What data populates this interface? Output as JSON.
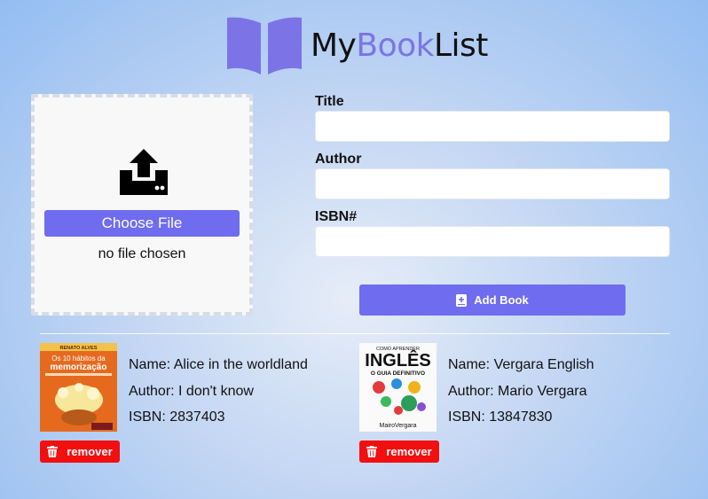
{
  "header": {
    "brand_part1": "My",
    "brand_part2": "Book",
    "brand_part3": "List",
    "logo_icon": "open-book-icon"
  },
  "upload": {
    "icon": "upload-icon",
    "choose_label": "Choose File",
    "status": "no file chosen"
  },
  "form": {
    "title_label": "Title",
    "title_value": "",
    "author_label": "Author",
    "author_value": "",
    "isbn_label": "ISBN#",
    "isbn_value": "",
    "add_label": "Add Book",
    "add_icon": "book-plus-icon"
  },
  "books": [
    {
      "cover_author": "RENATO ALVES",
      "cover_title_a": "Os 10 hábitos da",
      "cover_title_b": "memorização",
      "name": "Name: Alice in the worldland",
      "author": "Author: I don't know",
      "isbn": "ISBN: 2837403",
      "remove_label": "remover"
    },
    {
      "cover_top": "COMO APRENDER",
      "cover_title": "INGLÊS",
      "cover_subtitle": "O GUIA DEFINITIVO",
      "cover_author": "MairoVergara",
      "name": "Name: Vergara English",
      "author": "Author: Mario Vergara",
      "isbn": "ISBN: 13847830",
      "remove_label": "remover"
    }
  ],
  "colors": {
    "accent": "#6f6cef",
    "brand_accent": "#7c74e6",
    "danger": "#f20f0f"
  }
}
